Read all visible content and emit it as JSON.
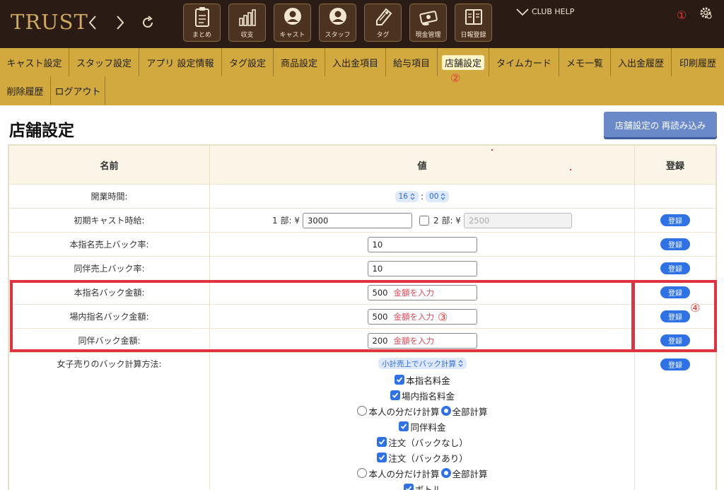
{
  "header": {
    "logo": "TRUST",
    "toolbar": [
      {
        "label": "まとめ",
        "icon": "clipboard-icon"
      },
      {
        "label": "収支",
        "icon": "bar-chart-icon"
      },
      {
        "label": "キャスト",
        "icon": "cast-icon"
      },
      {
        "label": "スタッフ",
        "icon": "staff-icon"
      },
      {
        "label": "タグ",
        "icon": "tag-icon"
      },
      {
        "label": "現金管理",
        "icon": "cash-icon"
      },
      {
        "label": "日報登録",
        "icon": "book-icon"
      }
    ],
    "help_label": "CLUB HELP",
    "annotation": "①"
  },
  "tabs": [
    {
      "label": "キャスト設定"
    },
    {
      "label": "スタッフ設定"
    },
    {
      "label": "アプリ 設定情報"
    },
    {
      "label": "タグ設定"
    },
    {
      "label": "商品設定"
    },
    {
      "label": "入出金項目"
    },
    {
      "label": "給与項目"
    },
    {
      "label": "店舗設定",
      "active": true
    },
    {
      "label": "タイムカード"
    },
    {
      "label": "メモ一覧"
    },
    {
      "label": "入出金履歴"
    },
    {
      "label": "印刷履歴"
    },
    {
      "label": "削除履歴"
    },
    {
      "label": "ログアウト"
    }
  ],
  "tabs_annotation": "②",
  "page": {
    "title": "店舗設定",
    "reload_button": "店舗設定の 再読み込み"
  },
  "table": {
    "headers": {
      "name": "名前",
      "value": "値",
      "register": "登録"
    },
    "register_label": "登録",
    "rows": [
      {
        "name": "開業時間:",
        "hour": "16",
        "minute": "00",
        "colon": ":"
      },
      {
        "name": "初期キャスト時給:",
        "part1_label": "1 部: ¥",
        "part1_value": "3000",
        "part2_label": "2 部: ¥",
        "part2_placeholder": "2500"
      },
      {
        "name": "本指名売上バック率:",
        "value": "10"
      },
      {
        "name": "同伴売上バック率:",
        "value": "10"
      },
      {
        "name": "本指名バック金額:",
        "value": "500",
        "placeholder": "金額を入力"
      },
      {
        "name": "場内指名バック金額:",
        "value": "500",
        "placeholder": "金額を入力"
      },
      {
        "name": "同伴バック金額:",
        "value": "200",
        "placeholder": "金額を入力"
      },
      {
        "name": "女子売りのバック計算方法:",
        "select": "小計売上でバック計算"
      }
    ],
    "options": [
      {
        "type": "checkbox",
        "label": "本指名料金",
        "checked": true
      },
      {
        "type": "checkbox",
        "label": "場内指名料金",
        "checked": true
      },
      {
        "type": "radio",
        "label_a": "本人の分だけ計算",
        "label_b": "全部計算",
        "selected": "b"
      },
      {
        "type": "checkbox",
        "label": "同伴料金",
        "checked": true
      },
      {
        "type": "checkbox",
        "label": "注文（バックなし）",
        "checked": true
      },
      {
        "type": "checkbox",
        "label": "注文（バックあり）",
        "checked": true
      },
      {
        "type": "radio",
        "label_a": "本人の分だけ計算",
        "label_b": "全部計算",
        "selected": "b"
      },
      {
        "type": "checkbox",
        "label": "ボトル",
        "checked": true
      }
    ],
    "annotation_value": "③",
    "annotation_register": "④"
  },
  "colors": {
    "topbar": "#2a1c15",
    "tabbar": "#d2a93f",
    "accent": "#2e72e6",
    "annotation": "#e03340"
  }
}
